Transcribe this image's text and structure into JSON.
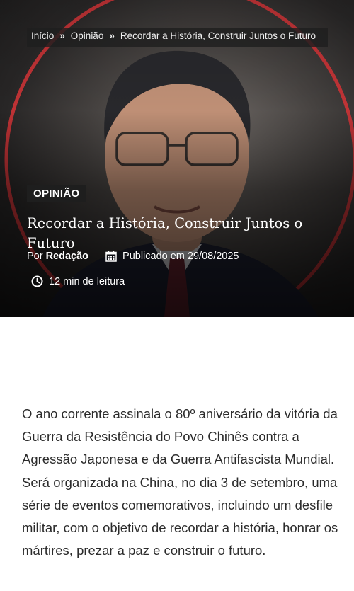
{
  "breadcrumb": {
    "home": "Início",
    "section": "Opinião",
    "current": "Recordar a História, Construir Juntos o Futuro",
    "separator": "»"
  },
  "article": {
    "category": "OPINIÃO",
    "title": "Recordar a História, Construir Juntos o Futuro",
    "author_prefix": "Por",
    "author": "Redação",
    "published": "Publicado em 29/08/2025",
    "reading_time": "12 min de leitura",
    "body": "O ano corrente assinala o 80º aniversário da vitória da Guerra da Resistência do Povo Chinês contra a Agressão Japonesa e da Guerra Antifascista Mundial. Será organizada na China, no dia 3 de setembro, uma série de eventos comemorativos, incluindo um desfile militar, com o objetivo de recordar a história, honrar os mártires, prezar a paz e construir o futuro."
  },
  "colors": {
    "accent_ring": "#d9363a",
    "category_bg": "#1e1e1e",
    "body_text": "#2b2b2b"
  },
  "icons": {
    "calendar": "calendar-icon",
    "clock": "clock-icon",
    "separator": "double-chevron-icon"
  }
}
